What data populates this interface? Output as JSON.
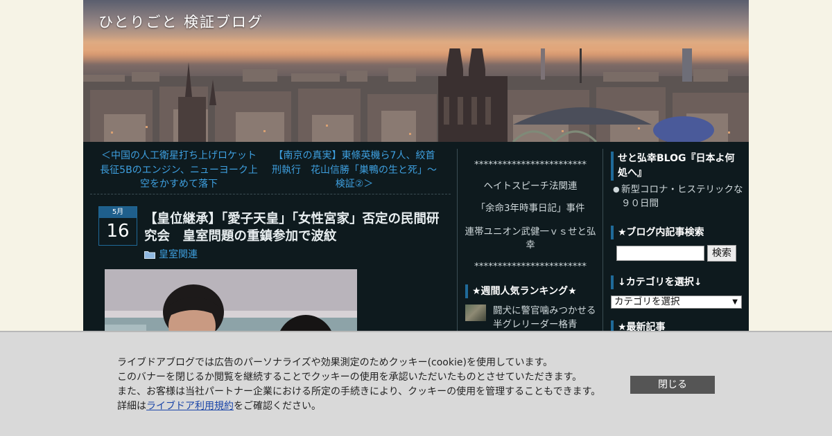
{
  "header": {
    "site_title": "ひとりごと 検証ブログ"
  },
  "post_nav": {
    "prev_label": "＜中国の人工衛星打ち上げロケット長征5Bのエンジン、ニューヨーク上空をかすめて落下",
    "next_label": "【南京の真実】東條英機ら7人、絞首刑執行　花山信勝「巣鴨の生と死」～検証②＞"
  },
  "post": {
    "date_month": "5月",
    "date_day": "16",
    "title": "【皇位継承】「愛子天皇」「女性宮家」否定の民間研究会　皇室問題の重鎮参加で波紋",
    "category": "皇室関連",
    "folder_icon": "folder-icon"
  },
  "mid_sidebar": {
    "links": [
      "************************",
      "ヘイトスピーチ法関連",
      "「余命3年時事日記」事件",
      "連帯ユニオン武健一ｖｓせと弘幸",
      "************************"
    ],
    "ranking_heading": "★週間人気ランキング★",
    "ranking_items": [
      "闘犬に警官噛みつかせる　半グレリーダー格青"
    ]
  },
  "right_sidebar": {
    "blog_heading": "せと弘幸BLOG『日本よ何処へ』",
    "blog_items": [
      "新型コロナ・ヒステリックな９０日間"
    ],
    "search_heading": "★ブログ内記事検索",
    "search_button": "検索",
    "search_value": "",
    "category_heading": "↓カテゴリを選択↓",
    "category_select": "カテゴリを選択",
    "latest_heading": "★最新記事"
  },
  "cookie_banner": {
    "line1": "ライブドアブログでは広告のパーソナライズや効果測定のためクッキー(cookie)を使用しています。",
    "line2": "このバナーを閉じるか閲覧を継続することでクッキーの使用を承認いただいたものとさせていただきます。",
    "line3": "また、お客様は当社パートナー企業における所定の手続きにより、クッキーの使用を管理することもできます。",
    "line4_prefix": "詳細は",
    "line4_link": "ライブドア利用規約",
    "line4_suffix": "をご確認ください。",
    "close_label": "閉じる"
  }
}
